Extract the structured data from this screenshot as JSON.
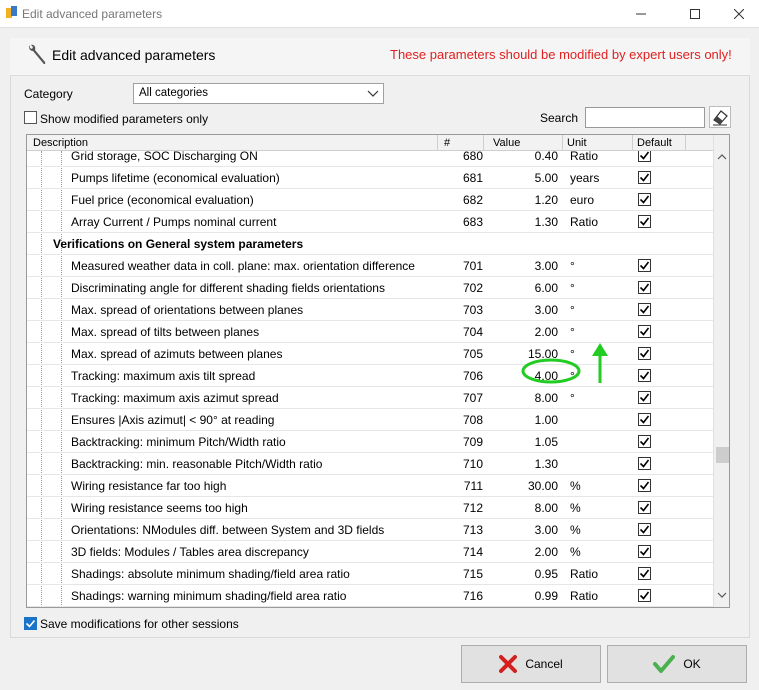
{
  "window": {
    "title": "Edit advanced parameters"
  },
  "header": {
    "heading": "Edit advanced parameters",
    "warning": "These parameters should be modified by expert users only!"
  },
  "filters": {
    "category_label": "Category",
    "category_value": "All categories",
    "show_modified_label": "Show modified parameters only",
    "show_modified_checked": false,
    "search_label": "Search",
    "search_value": ""
  },
  "table": {
    "columns": [
      "Description",
      "#",
      "Value",
      "Unit",
      "Default"
    ],
    "rows": [
      {
        "desc": "Grid storage, SOC Discharging ON",
        "num": "680",
        "val": "0.40",
        "unit": "Ratio",
        "default": true
      },
      {
        "desc": "Pumps lifetime (economical evaluation)",
        "num": "681",
        "val": "5.00",
        "unit": "years",
        "default": true
      },
      {
        "desc": "Fuel price (economical evaluation)",
        "num": "682",
        "val": "1.20",
        "unit": "euro",
        "default": true
      },
      {
        "desc": "Array Current / Pumps nominal current",
        "num": "683",
        "val": "1.30",
        "unit": "Ratio",
        "default": true
      },
      {
        "group": "Verifications on General system parameters"
      },
      {
        "desc": "Measured weather data in coll. plane: max. orientation difference",
        "num": "701",
        "val": "3.00",
        "unit": "°",
        "default": true
      },
      {
        "desc": "Discriminating angle for different shading fields orientations",
        "num": "702",
        "val": "6.00",
        "unit": "°",
        "default": true
      },
      {
        "desc": "Max. spread of orientations between planes",
        "num": "703",
        "val": "3.00",
        "unit": "°",
        "default": true
      },
      {
        "desc": "Max. spread of tilts between planes",
        "num": "704",
        "val": "2.00",
        "unit": "°",
        "default": true
      },
      {
        "desc": "Max. spread of azimuts between planes",
        "num": "705",
        "val": "15.00",
        "unit": "°",
        "default": true
      },
      {
        "desc": "Tracking: maximum axis tilt spread",
        "num": "706",
        "val": "4.00",
        "unit": "°",
        "default": true
      },
      {
        "desc": "Tracking: maximum axis azimut spread",
        "num": "707",
        "val": "8.00",
        "unit": "°",
        "default": true
      },
      {
        "desc": "Ensures |Axis azimut| < 90° at reading",
        "num": "708",
        "val": "1.00",
        "unit": "",
        "default": true
      },
      {
        "desc": "Backtracking: minimum Pitch/Width ratio",
        "num": "709",
        "val": "1.05",
        "unit": "",
        "default": true
      },
      {
        "desc": "Backtracking: min. reasonable Pitch/Width ratio",
        "num": "710",
        "val": "1.30",
        "unit": "",
        "default": true
      },
      {
        "desc": "Wiring resistance far too high",
        "num": "711",
        "val": "30.00",
        "unit": "%",
        "default": true
      },
      {
        "desc": "Wiring resistance seems too high",
        "num": "712",
        "val": "8.00",
        "unit": "%",
        "default": true
      },
      {
        "desc": "Orientations: NModules diff. between System and 3D fields",
        "num": "713",
        "val": "3.00",
        "unit": "%",
        "default": true
      },
      {
        "desc": "3D fields: Modules / Tables area discrepancy",
        "num": "714",
        "val": "2.00",
        "unit": "%",
        "default": true
      },
      {
        "desc": "Shadings: absolute minimum shading/field area ratio",
        "num": "715",
        "val": "0.95",
        "unit": "Ratio",
        "default": true
      },
      {
        "desc": "Shadings: warning minimum shading/field area ratio",
        "num": "716",
        "val": "0.99",
        "unit": "Ratio",
        "default": true
      }
    ]
  },
  "footer": {
    "save_label": "Save modifications for other sessions",
    "save_checked": true,
    "cancel_label": "Cancel",
    "ok_label": "OK"
  },
  "colors": {
    "warning": "#e02020",
    "annotation": "#22cc22",
    "cancel_icon": "#d42020",
    "ok_icon": "#4caf50"
  },
  "icons": {
    "heading": "wrench-icon",
    "eraser": "eraser-icon",
    "cancel": "x-icon",
    "ok": "check-icon"
  }
}
